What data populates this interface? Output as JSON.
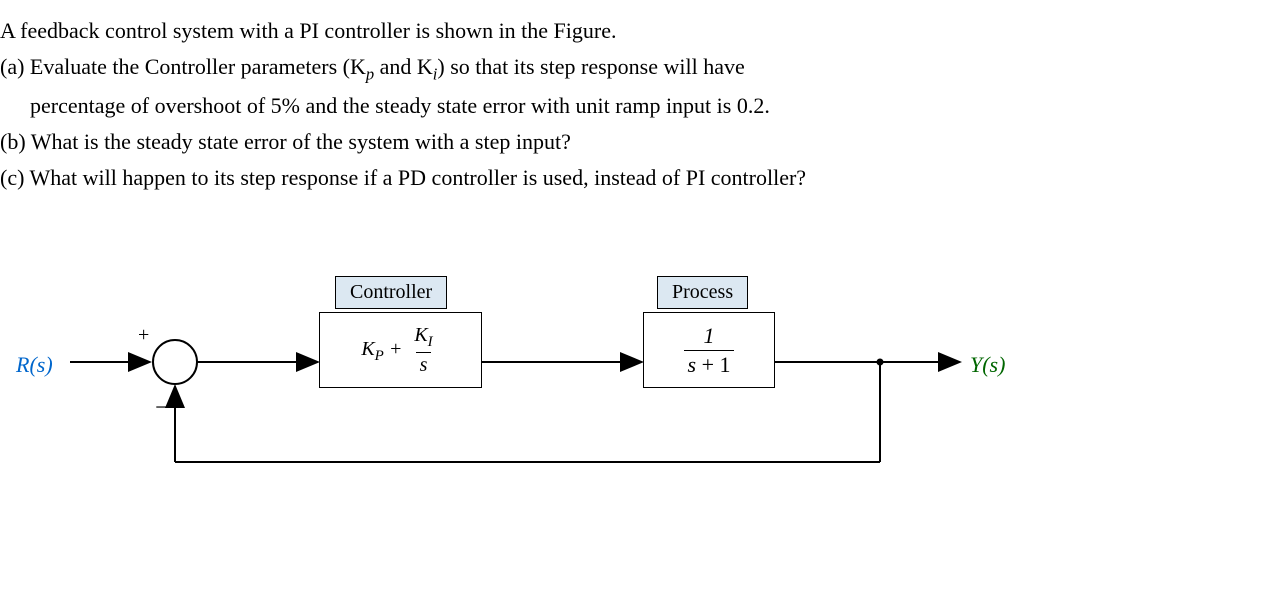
{
  "intro": "A feedback control system with a PI controller is shown in the Figure.",
  "parts": {
    "a_line1": "(a) Evaluate the Controller parameters (K",
    "a_sub1": "p",
    "a_mid": " and K",
    "a_sub2": "i",
    "a_line1_end": ") so that its step response will have",
    "a_line2": "percentage of overshoot of 5% and the steady state error with unit ramp input is 0.2.",
    "b": "(b) What is the steady state error of the system with a step input?",
    "c": "(c) What will happen to its step response if a PD controller is used, instead of PI controller?"
  },
  "diagram": {
    "input": "R(s)",
    "output": "Y(s)",
    "plus": "+",
    "minus": "−",
    "controller_label": "Controller",
    "process_label": "Process",
    "controller_tf": {
      "Kp": "K",
      "Kp_sub": "P",
      "op": " + ",
      "Ki_num": "K",
      "Ki_num_sub": "I",
      "Ki_den": "s"
    },
    "process_tf": {
      "num": "1",
      "den_left": "s",
      "den_op": " + ",
      "den_right": "1"
    }
  },
  "chart_data": {
    "type": "block-diagram",
    "nodes": [
      {
        "id": "R",
        "type": "input",
        "label": "R(s)"
      },
      {
        "id": "sum",
        "type": "summing-junction",
        "inputs": [
          {
            "sign": "+",
            "from": "R"
          },
          {
            "sign": "-",
            "from": "Y"
          }
        ]
      },
      {
        "id": "controller",
        "type": "transfer-function",
        "label": "Controller",
        "tf": "Kp + Ki/s"
      },
      {
        "id": "process",
        "type": "transfer-function",
        "label": "Process",
        "tf": "1/(s+1)"
      },
      {
        "id": "Y",
        "type": "output",
        "label": "Y(s)"
      }
    ],
    "edges": [
      {
        "from": "R",
        "to": "sum"
      },
      {
        "from": "sum",
        "to": "controller"
      },
      {
        "from": "controller",
        "to": "process"
      },
      {
        "from": "process",
        "to": "Y"
      },
      {
        "from": "Y",
        "to": "sum",
        "feedback": true,
        "sign": "-"
      }
    ]
  }
}
